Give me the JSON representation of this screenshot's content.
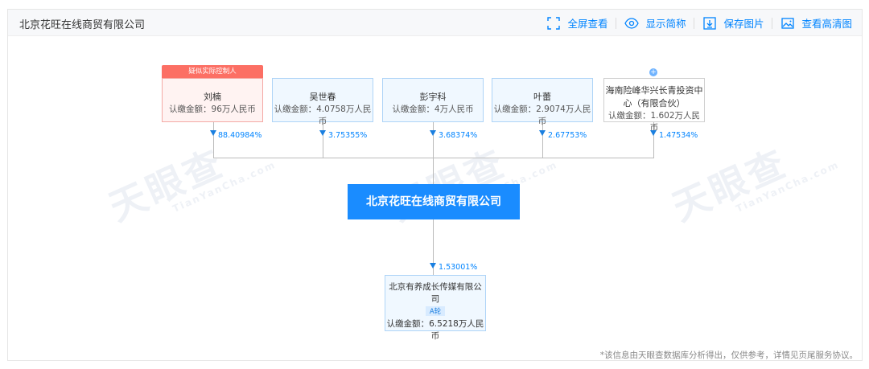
{
  "header": {
    "title": "北京花旺在线商贸有限公司"
  },
  "toolbar": {
    "fullscreen": "全屏查看",
    "show_short": "显示简称",
    "save_image": "保存图片",
    "hd_view": "查看高清图"
  },
  "watermark": {
    "text": "天眼查",
    "sub": "TianYanCha.com"
  },
  "shareholders": [
    {
      "tag": "疑似实际控制人",
      "name": "刘楠",
      "amount": "认缴金额：96万人民币",
      "pct": "88.40984%"
    },
    {
      "name": "吴世春",
      "amount": "认缴金额：4.0758万人民币",
      "pct": "3.75355%"
    },
    {
      "name": "彭宇科",
      "amount": "认缴金额：4万人民币",
      "pct": "3.68374%"
    },
    {
      "name": "叶蕾",
      "amount": "认缴金额：2.9074万人民币",
      "pct": "2.67753%"
    },
    {
      "name_line1": "海南险峰华兴长青投资中",
      "name_line2": "心（有限合伙）",
      "amount": "认缴金额：1.602万人民币",
      "pct": "1.47534%"
    }
  ],
  "company": {
    "name": "北京花旺在线商贸有限公司"
  },
  "investment": {
    "pct": "1.53001%",
    "name_line1": "北京有养成长传媒有限公",
    "name_line2": "司",
    "round": "A轮",
    "amount": "认缴金额：6.5218万人民币"
  },
  "footnote": "*该信息由天眼查数据库分析得出，仅供参考，详情见页尾服务协议。"
}
